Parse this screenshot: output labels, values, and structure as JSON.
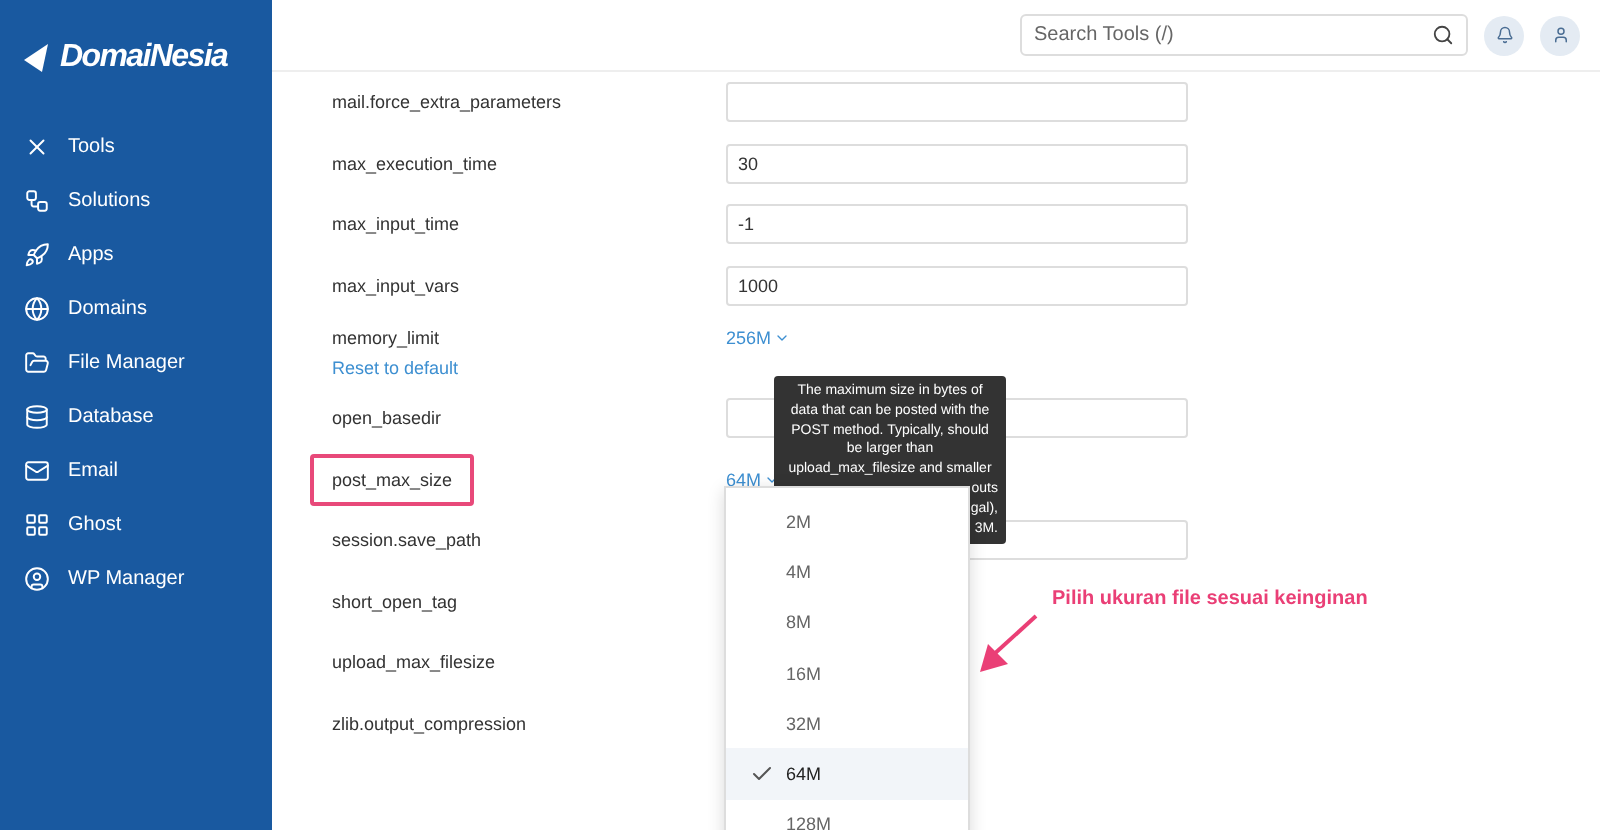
{
  "sidebar": {
    "logo": "DomaiNesia",
    "items": [
      {
        "label": "Tools"
      },
      {
        "label": "Solutions"
      },
      {
        "label": "Apps"
      },
      {
        "label": "Domains"
      },
      {
        "label": "File Manager"
      },
      {
        "label": "Database"
      },
      {
        "label": "Email"
      },
      {
        "label": "Ghost"
      },
      {
        "label": "WP Manager"
      }
    ]
  },
  "header": {
    "search": {
      "placeholder": "Search Tools (/)"
    }
  },
  "settings": [
    {
      "name": "mail.force_extra_parameters",
      "kind": "input",
      "highlighted": false
    },
    {
      "name": "max_execution_time",
      "kind": "input",
      "value": "30",
      "highlighted": false
    },
    {
      "name": "max_input_time",
      "kind": "input",
      "value": "-1",
      "highlighted": false
    },
    {
      "name": "max_input_vars",
      "kind": "input",
      "value": "1000",
      "highlighted": false
    },
    {
      "name": "memory_limit",
      "kind": "select",
      "value": "256M",
      "reset": "Reset to default",
      "highlighted": false
    },
    {
      "name": "open_basedir",
      "kind": "input",
      "highlighted": false
    },
    {
      "name": "post_max_size",
      "kind": "select",
      "value": "64M",
      "highlighted": true
    },
    {
      "name": "session.save_path",
      "kind": "input",
      "highlighted": false
    },
    {
      "name": "short_open_tag",
      "kind": "hidden",
      "highlighted": false
    },
    {
      "name": "upload_max_filesize",
      "kind": "hidden",
      "highlighted": false
    },
    {
      "name": "zlib.output_compression",
      "kind": "hidden",
      "highlighted": false
    }
  ],
  "tooltip": {
    "lines": [
      "The maximum size in bytes of",
      "data that can be posted with the",
      "POST method. Typically, should",
      "be larger than",
      "upload_max_filesize and smaller"
    ],
    "partial_lines": [
      "outs",
      "gal),",
      "3M."
    ]
  },
  "dropdown": {
    "options": [
      {
        "label": "2M",
        "selected": false
      },
      {
        "label": "4M",
        "selected": false
      },
      {
        "label": "8M",
        "selected": false
      },
      {
        "label": "16M",
        "selected": false
      },
      {
        "label": "32M",
        "selected": false
      },
      {
        "label": "64M",
        "selected": true
      },
      {
        "label": "128M",
        "selected": false
      }
    ]
  },
  "annotation": {
    "text": "Pilih ukuran file sesuai keinginan"
  }
}
